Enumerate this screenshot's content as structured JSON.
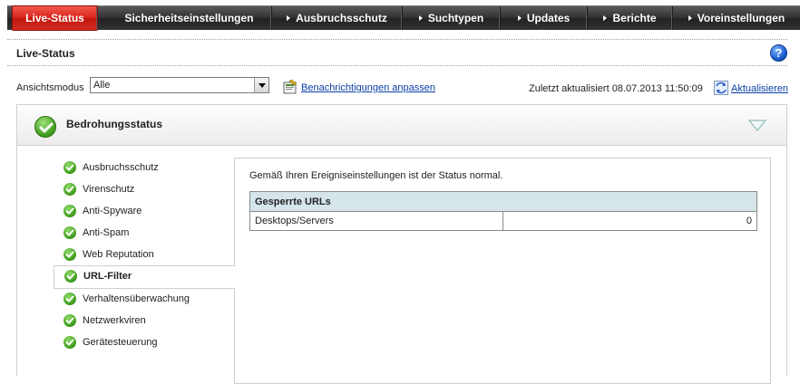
{
  "nav": {
    "tabs": [
      {
        "label": "Live-Status",
        "active": true
      },
      {
        "label": "Sicherheitseinstellungen"
      },
      {
        "label": "Ausbruchsschutz"
      },
      {
        "label": "Suchtypen"
      },
      {
        "label": "Updates"
      },
      {
        "label": "Berichte"
      },
      {
        "label": "Voreinstellungen"
      }
    ]
  },
  "page": {
    "title": "Live-Status",
    "help_label": "?"
  },
  "toolbar": {
    "view_mode_label": "Ansichtsmodus",
    "view_mode_value": "Alle",
    "notify_link": "Benachrichtigungen anpassen",
    "updated_label": "Zuletzt aktualisiert",
    "updated_value": "08.07.2013 11:50:09",
    "refresh_link": "Aktualisieren"
  },
  "threat": {
    "title": "Bedrohungsstatus",
    "items": [
      {
        "label": "Ausbruchsschutz"
      },
      {
        "label": "Virenschutz"
      },
      {
        "label": "Anti-Spyware"
      },
      {
        "label": "Anti-Spam"
      },
      {
        "label": "Web Reputation"
      },
      {
        "label": "URL-Filter",
        "active": true
      },
      {
        "label": "Verhaltensüberwachung"
      },
      {
        "label": "Netzwerkviren"
      },
      {
        "label": "Gerätesteuerung"
      }
    ],
    "detail": {
      "status_text": "Gemäß Ihren Ereigniseinstellungen ist der Status normal.",
      "table_header": "Gesperrte URLs",
      "rows": [
        {
          "name": "Desktops/Servers",
          "value": "0"
        }
      ]
    }
  },
  "colors": {
    "active_tab": "#d8231a",
    "nav_bg": "#333333",
    "table_header_bg": "#d5e5ea",
    "link": "#0a3ea6",
    "ok_green": "#3f9b1c"
  }
}
